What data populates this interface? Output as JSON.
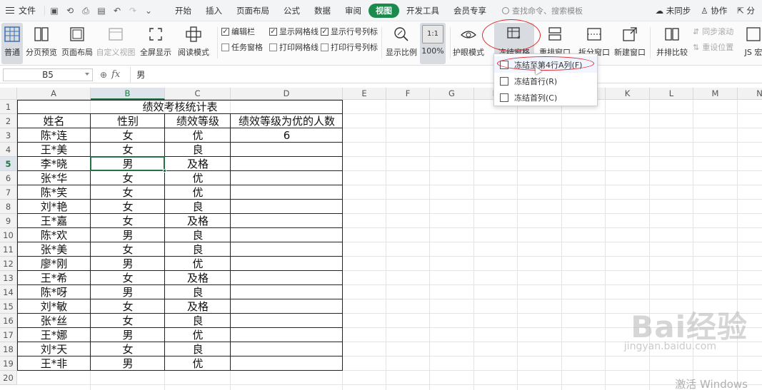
{
  "menubar": {
    "file_label": "文件",
    "tabs": [
      "开始",
      "插入",
      "页面布局",
      "公式",
      "数据",
      "审阅",
      "视图",
      "开发工具",
      "会员专享"
    ],
    "active_tab": "视图",
    "command_search_placeholder": "查找命令、搜索模板",
    "sync_label": "未同步",
    "collab_label": "协作",
    "share_label": "分"
  },
  "ribbon": {
    "normal": "普通",
    "page_break": "分页预览",
    "page_layout": "页面布局",
    "custom_view": "自定义视图",
    "fullscreen": "全屏显示",
    "reading_mode": "阅读模式",
    "checks": {
      "edit_bar": "编辑栏",
      "show_gridlines": "显示网格线",
      "show_headers": "显示行号列标",
      "task_pane": "任务窗格",
      "print_gridlines": "打印网格线",
      "print_headers": "打印行号列标"
    },
    "zoom": "显示比例",
    "zoom100": "100%",
    "zoom100_box": "1:1",
    "eye_mode": "护眼模式",
    "freeze_panes": "冻结窗格",
    "arrange": "重排窗口",
    "split": "拆分窗口",
    "new_window": "新建窗口",
    "side_by_side": "并排比较",
    "sync_scroll": "同步滚动",
    "reset_position": "重设位置",
    "js": "JS 宏"
  },
  "freeze_menu": [
    {
      "label": "冻结至第4行A列(F)"
    },
    {
      "label": "冻结首行(R)"
    },
    {
      "label": "冻结首列(C)"
    }
  ],
  "formula_bar": {
    "cell_ref": "B5",
    "fx": "fx",
    "content": "男"
  },
  "columns": [
    "A",
    "B",
    "C",
    "D",
    "E",
    "F",
    "G",
    "H",
    "I",
    "J",
    "K",
    "L",
    "M",
    "N"
  ],
  "rows": [
    "1",
    "2",
    "3",
    "4",
    "5",
    "6",
    "7",
    "8",
    "9",
    "10",
    "11",
    "12",
    "13",
    "14",
    "15",
    "16",
    "17",
    "18",
    "19",
    "20"
  ],
  "sheet": {
    "title": "绩效考核统计表",
    "headers": [
      "姓名",
      "性别",
      "绩效等级",
      "绩效等级为优的人数"
    ],
    "count_value": "6",
    "records": [
      [
        "陈*连",
        "女",
        "优"
      ],
      [
        "王*美",
        "女",
        "良"
      ],
      [
        "李*晓",
        "男",
        "及格"
      ],
      [
        "张*华",
        "女",
        "优"
      ],
      [
        "陈*笑",
        "女",
        "优"
      ],
      [
        "刘*艳",
        "女",
        "良"
      ],
      [
        "王*嘉",
        "女",
        "及格"
      ],
      [
        "陈*欢",
        "男",
        "良"
      ],
      [
        "张*美",
        "女",
        "良"
      ],
      [
        "廖*刚",
        "男",
        "优"
      ],
      [
        "王*希",
        "女",
        "及格"
      ],
      [
        "陈*呀",
        "男",
        "良"
      ],
      [
        "刘*敏",
        "女",
        "及格"
      ],
      [
        "张*丝",
        "女",
        "良"
      ],
      [
        "王*娜",
        "男",
        "优"
      ],
      [
        "刘*天",
        "女",
        "良"
      ],
      [
        "王*非",
        "男",
        "优"
      ]
    ]
  },
  "watermark": {
    "brand": "Bai经验",
    "url": "jingyan.baidu.com",
    "activate": "激活 Windows"
  }
}
